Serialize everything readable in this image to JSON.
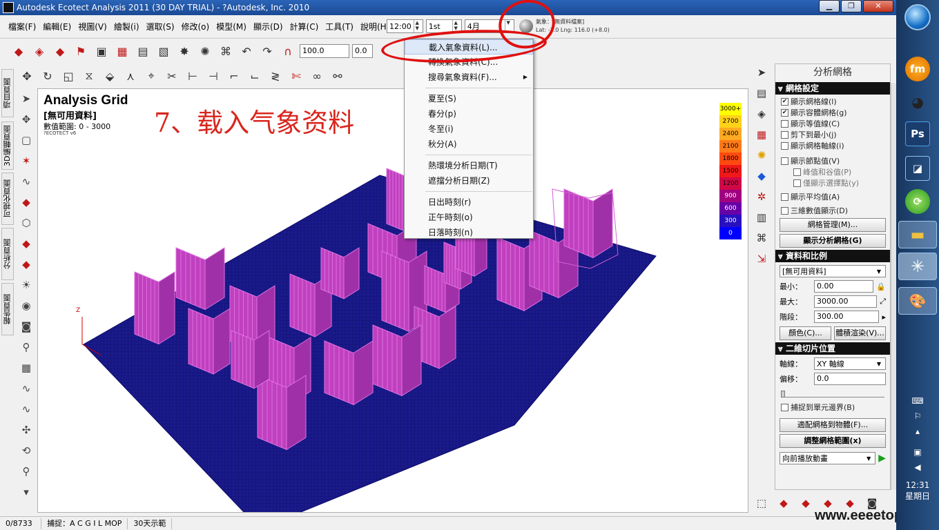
{
  "titlebar": {
    "title": "Autodesk Ecotect Analysis 2011 (30 DAY TRIAL) - ?Autodesk, Inc. 2010",
    "minimize": "▁",
    "restore": "❐",
    "close": "✕"
  },
  "menubar": {
    "items": [
      "檔案(F)",
      "編輯(E)",
      "視圖(V)",
      "繪製(i)",
      "選取(S)",
      "修改(o)",
      "模型(M)",
      "顯示(D)",
      "計算(C)",
      "工具(T)",
      "說明(H)"
    ]
  },
  "time_controls": {
    "time": "12:00",
    "day": "1st",
    "month": "4月"
  },
  "weather_info": {
    "line1": "氣象：[無資料檔案]",
    "line2": "Lat: -3.0   Lng: 116.0  (+8.0)"
  },
  "toolbar": {
    "zoom_value": "100.0",
    "other_value": "0.0"
  },
  "left_tabs": [
    "項目頁面",
    "3D編輯頁面",
    "可視化頁面",
    "分析頁面",
    "報告頁面"
  ],
  "viewport": {
    "title": "Analysis Grid",
    "subtitle": "[無可用資料]",
    "range": "數值範圍: 0 - 3000",
    "version": "?ECOTECT v6",
    "axis_z": "Z"
  },
  "annotation": "7、载入气象资料",
  "legend": [
    {
      "label": "3000+",
      "color": "#ffff00"
    },
    {
      "label": "2700",
      "color": "#ffd21a"
    },
    {
      "label": "2400",
      "color": "#ffaa22"
    },
    {
      "label": "2100",
      "color": "#ff7a18"
    },
    {
      "label": "1800",
      "color": "#ff4a10"
    },
    {
      "label": "1500",
      "color": "#f01818"
    },
    {
      "label": "1200",
      "color": "#d00848"
    },
    {
      "label": "900",
      "color": "#a00080"
    },
    {
      "label": "600",
      "color": "#6800a8"
    },
    {
      "label": "300",
      "color": "#2810c0"
    },
    {
      "label": "0",
      "color": "#0000ff"
    }
  ],
  "context_menu": {
    "items": [
      {
        "label": "載入氣象資料(L)...",
        "highlight": true
      },
      {
        "label": "轉換氣象資料(C)..."
      },
      {
        "label": "搜尋氣象資料(F)...",
        "submenu": true
      },
      {
        "sep": true
      },
      {
        "label": "夏至(S)"
      },
      {
        "label": "春分(p)"
      },
      {
        "label": "冬至(i)"
      },
      {
        "label": "秋分(A)"
      },
      {
        "sep": true
      },
      {
        "label": "熱環境分析日期(T)"
      },
      {
        "label": "遮擋分析日期(Z)"
      },
      {
        "sep": true
      },
      {
        "label": "日出時刻(r)"
      },
      {
        "label": "正午時刻(o)"
      },
      {
        "label": "日落時刻(n)"
      }
    ]
  },
  "panel": {
    "title": "分析網格",
    "grid_settings": {
      "header": "網格設定",
      "show_grid_lines": "顯示網格線(l)",
      "show_volume_grid": "顯示容體網格(g)",
      "show_contours": "顯示等值線(C)",
      "clip_to_min": "剪下到最小(j)",
      "show_grid_axes": "顯示網格軸線(i)",
      "show_node_values": "顯示節點值(V)",
      "peak_valley": "峰值和谷值(P)",
      "show_selected_nodes": "僅顯示選擇點(y)",
      "show_average": "顯示平均值(A)",
      "show_3d_values": "三維數值顯示(D)",
      "grid_manage_btn": "網格管理(M)...",
      "show_analysis_grid_btn": "顯示分析網格(G)"
    },
    "data_scale": {
      "header": "資料和比例",
      "data_select": "[無可用資料]",
      "min_label": "最小：",
      "min_value": "0.00",
      "max_label": "最大：",
      "max_value": "3000.00",
      "step_label": "階段：",
      "step_value": "300.00",
      "color_btn": "顏色(C)...",
      "volume_render_btn": "體積渲染(V)..."
    },
    "slice": {
      "header": "二維切片位置",
      "axis_label": "軸線：",
      "axis_value": "XY 軸線",
      "offset_label": "偏移：",
      "offset_value": "0.0",
      "snap_label": "捕捉到單元邊界(B)",
      "fit_btn": "適配網格到物體(F)...",
      "adjust_btn": "調整網格範圍(x)",
      "play_select": "向前播放動畫"
    }
  },
  "statusbar": {
    "count": "0/8733",
    "snap_label": "捕捉：",
    "snap_modes": "A C G I  L MOP",
    "trial": "30天示範"
  },
  "watermark": "www.eeeetop.com",
  "taskbar": {
    "apps": [
      "fm",
      "QQ",
      "Ps",
      "",
      "",
      "",
      "",
      ""
    ],
    "time": "12:31",
    "day": "星期日"
  }
}
